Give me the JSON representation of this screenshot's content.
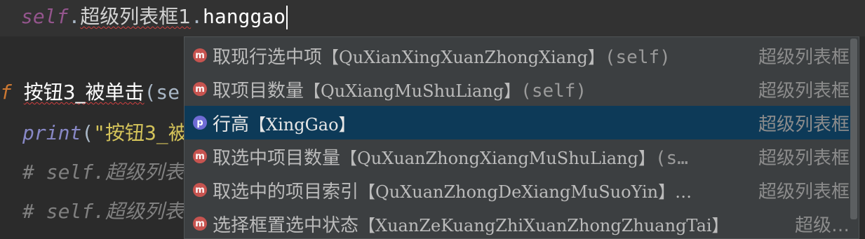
{
  "editor": {
    "line1": {
      "obj": "self",
      "widget": "超级列表框1",
      "attr": "hanggao"
    },
    "line2": {
      "kw": "f",
      "name": "按钮3_被单击",
      "rest": "(se"
    },
    "line3": {
      "builtin": "print",
      "paren": "(",
      "str": "\"按钮3_被"
    },
    "line4": {
      "comment": "# self.超级列表"
    },
    "line5": {
      "comment": "# self.超级列表"
    }
  },
  "completion": {
    "items": [
      {
        "kind": "m",
        "label": "取现行选中项",
        "pinyin": "【QuXianXingXuanZhongXiang】",
        "params": "(self)",
        "type": "超级列表框",
        "selected": false
      },
      {
        "kind": "m",
        "label": "取项目数量",
        "pinyin": "【QuXiangMuShuLiang】",
        "params": "(self)",
        "type": "超级列表框",
        "selected": false
      },
      {
        "kind": "p",
        "label": "行高",
        "pinyin": "【XingGao】",
        "params": "",
        "type": "超级列表框",
        "selected": true
      },
      {
        "kind": "m",
        "label": "取选中项目数量",
        "pinyin": "【QuXuanZhongXiangMuShuLiang】",
        "params": "(s…",
        "type": "超级列表框",
        "selected": false
      },
      {
        "kind": "m",
        "label": "取选中的项目索引",
        "pinyin": "【QuXuanZhongDeXiangMuSuoYin】…",
        "params": "",
        "type": "超级列表框",
        "selected": false
      },
      {
        "kind": "m",
        "label": "选择框置选中状态",
        "pinyin": "【XuanZeKuangZhiXuanZhongZhuangTai】",
        "params": "",
        "type": "超级…",
        "selected": false
      }
    ]
  },
  "colors": {
    "selection": "#0d3a58",
    "method_badge": "#c75450",
    "property_badge": "#6f6bd5"
  }
}
